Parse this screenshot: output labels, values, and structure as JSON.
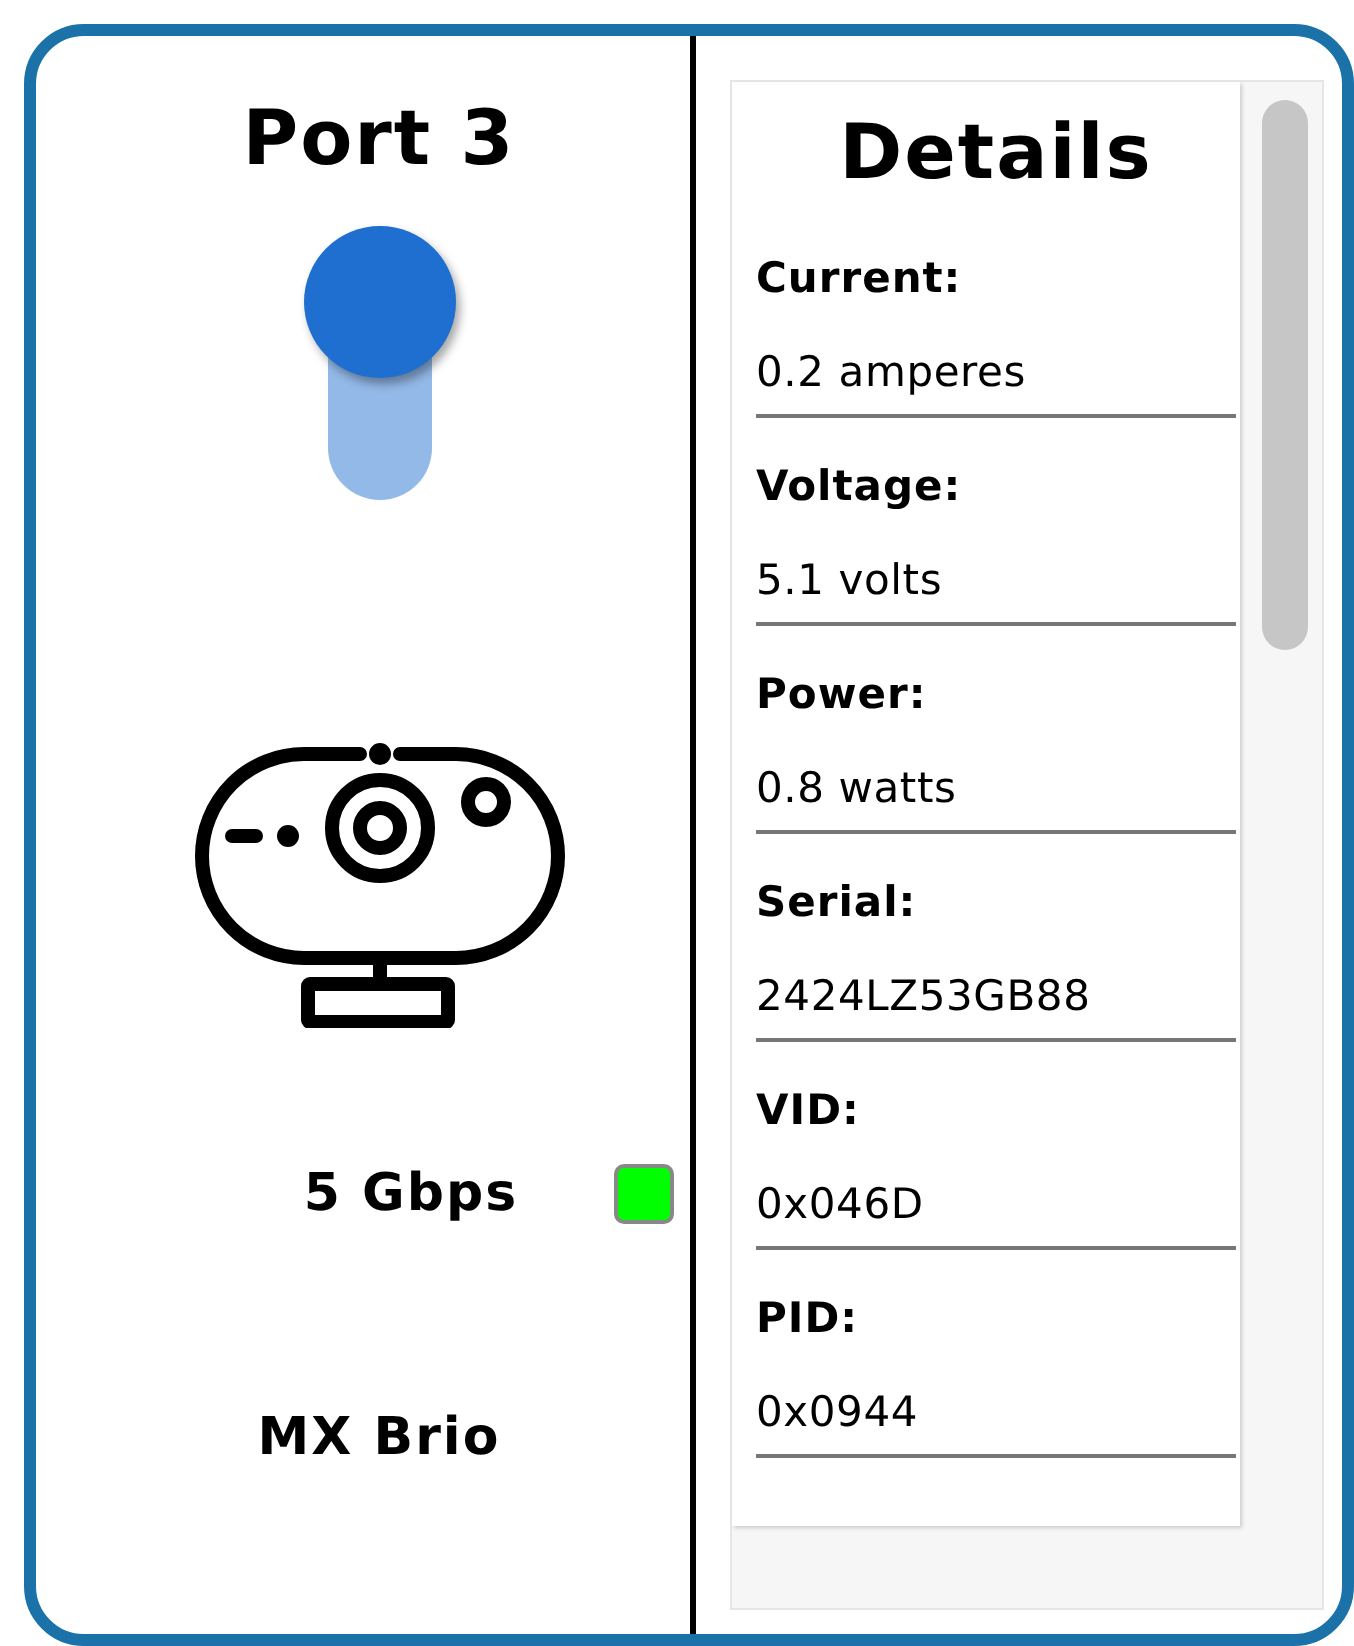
{
  "port": {
    "title": "Port 3",
    "enabled": true,
    "speed": "5 Gbps",
    "color": "#00ff00",
    "device_name": "MX Brio"
  },
  "details": {
    "title": "Details",
    "items": [
      {
        "label": "Current:",
        "value": "0.2 amperes"
      },
      {
        "label": "Voltage:",
        "value": "5.1 volts"
      },
      {
        "label": "Power:",
        "value": "0.8 watts"
      },
      {
        "label": "Serial:",
        "value": "2424LZ53GB88"
      },
      {
        "label": "VID:",
        "value": "0x046D"
      },
      {
        "label": "PID:",
        "value": "0x0944"
      }
    ]
  }
}
